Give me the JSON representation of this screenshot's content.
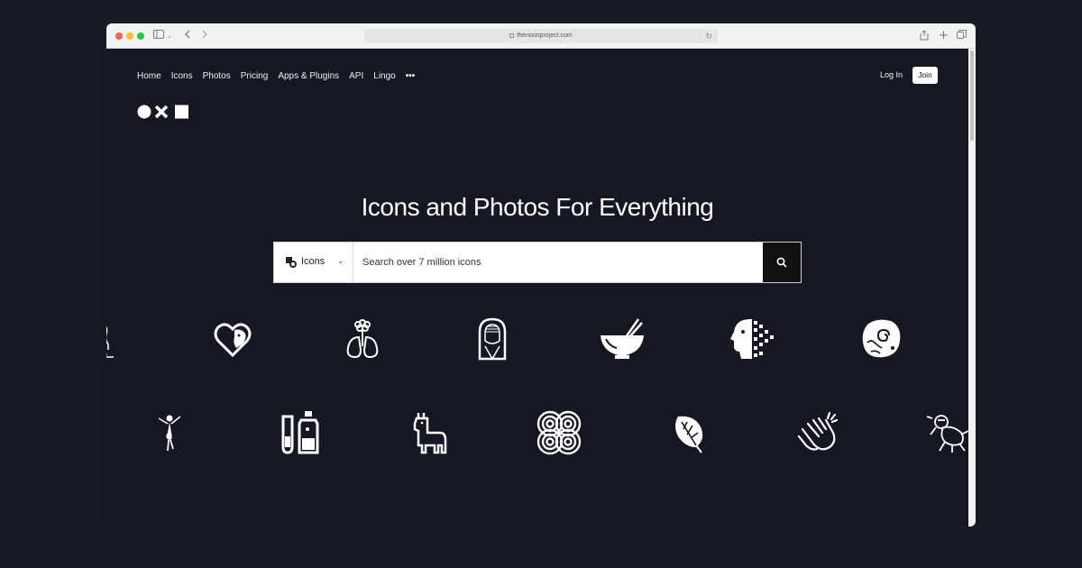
{
  "browser": {
    "url": "thenounproject.com"
  },
  "nav": {
    "items": [
      "Home",
      "Icons",
      "Photos",
      "Pricing",
      "Apps & Plugins",
      "API",
      "Lingo"
    ],
    "more_label": "•••",
    "login_label": "Log In",
    "join_label": "Join"
  },
  "hero": {
    "title": "Icons and Photos For Everything"
  },
  "search": {
    "type_label": "Icons",
    "placeholder": "Search over 7 million icons"
  },
  "showcase": {
    "row1": [
      "figure-partial-icon",
      "heart-face-icon",
      "flower-lungs-icon",
      "veiled-woman-icon",
      "bowl-chopsticks-icon",
      "pixel-head-icon",
      "fossil-icon"
    ],
    "row2": [
      "dancer-icon",
      "test-tube-bottle-icon",
      "llama-icon",
      "concentric-knot-icon",
      "monstera-leaf-icon",
      "clapping-hands-icon",
      "robot-crawler-icon"
    ]
  },
  "colors": {
    "background": "#161722",
    "text": "#ffffff",
    "search_button": "#111111"
  }
}
